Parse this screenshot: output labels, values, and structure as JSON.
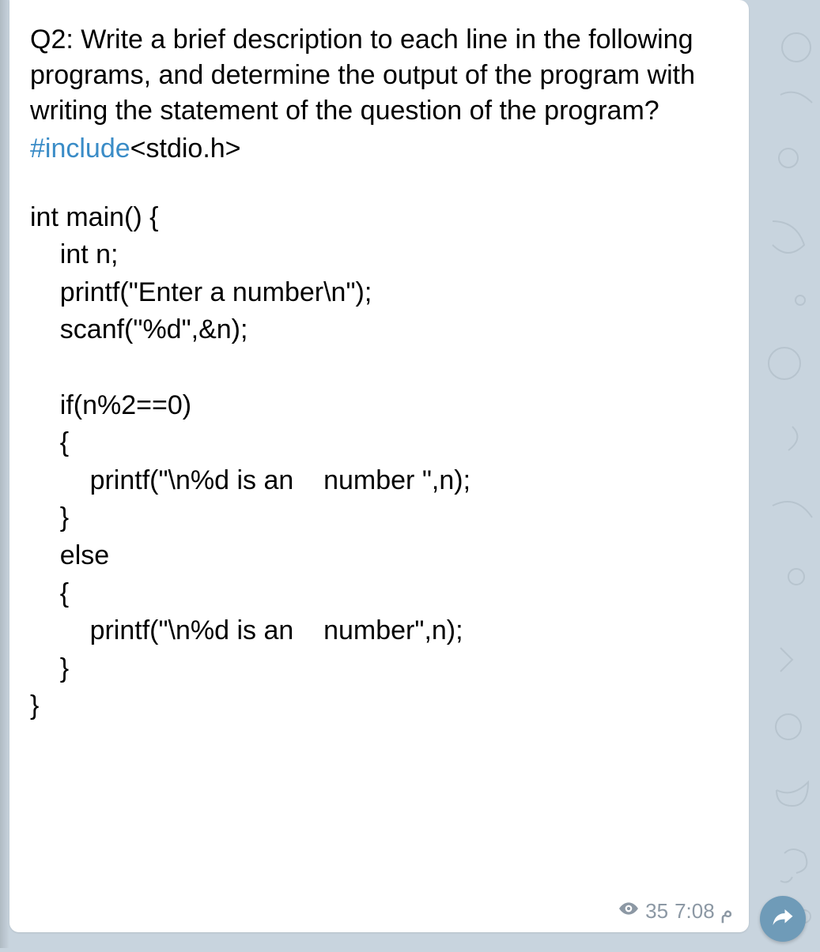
{
  "message": {
    "question": "Q2: Write  a brief description to each line in the following programs, and determine the output of the program with writing the statement of the question of the program?",
    "include_keyword": "#include",
    "include_rest": "<stdio.h>",
    "code_lines": [
      "int main() {",
      "    int n;",
      "    printf(\"Enter a number\\n\");",
      "    scanf(\"%d\",&n);",
      "",
      "    if(n%2==0)",
      "    {",
      "        printf(\"\\n%d is an    number \",n);",
      "    }",
      "    else",
      "    {",
      "        printf(\"\\n%d is an    number\",n);",
      "    }",
      "}"
    ]
  },
  "meta": {
    "views": "35",
    "time": "7:08 م"
  }
}
